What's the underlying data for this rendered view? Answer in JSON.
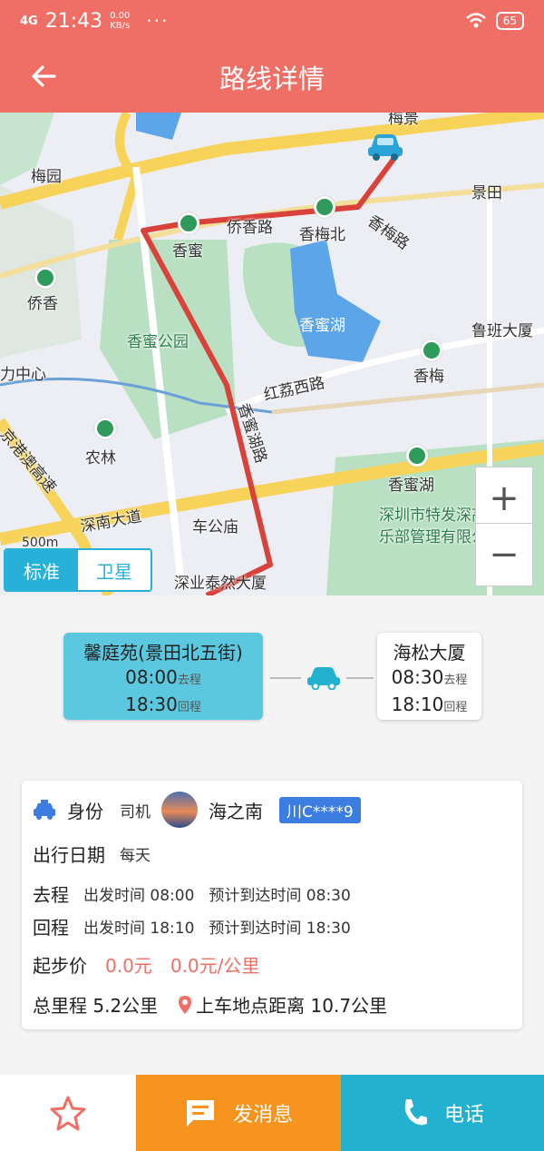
{
  "status_bar": {
    "network": "4G",
    "time": "21:43",
    "speed_value": "0.00",
    "speed_unit": "KB/s",
    "more": "···",
    "battery": "65"
  },
  "header": {
    "title": "路线详情"
  },
  "map": {
    "labels": {
      "meijing": "梅景",
      "meiyuan": "梅园",
      "jingtian": "景田",
      "qiaoxianglu": "侨香路",
      "xiangmi": "香蜜",
      "xiangmeibei": "香梅北",
      "xiangmeilu": "香梅路",
      "qiaoxiang": "侨香",
      "xiangmigongyuan": "香蜜公园",
      "xiangmihu": "香蜜湖",
      "lubandasha": "鲁班大厦",
      "lizhongxin": "力中心",
      "hongliwexilu": "红荔西路",
      "xiangmei": "香梅",
      "xiangmihulu": "香蜜湖路",
      "jinggangao": "京港澳高速",
      "nonglin": "农林",
      "xiangmihu2": "香蜜湖",
      "shennandadao": "深南大道",
      "chegongmiao": "车公庙",
      "club": "深圳市特发深高俱乐部管理有限公司",
      "shenyetairan": "深业泰然大厦",
      "scale": "500m"
    },
    "zoom_in": "+",
    "zoom_out": "−",
    "type_standard": "标准",
    "type_satellite": "卫星"
  },
  "route": {
    "from": {
      "name": "馨庭苑(景田北五街)",
      "go_time": "08:00",
      "go_label": "去程",
      "back_time": "18:30",
      "back_label": "回程"
    },
    "to": {
      "name": "海松大厦",
      "go_time": "08:30",
      "go_label": "去程",
      "back_time": "18:10",
      "back_label": "回程"
    }
  },
  "info": {
    "identity_label": "身份",
    "identity_value": "司机",
    "driver_name": "海之南",
    "plate": "川C****9",
    "date_label": "出行日期",
    "date_value": "每天",
    "go_label": "去程",
    "go_depart": "出发时间 08:00",
    "go_arrive": "预计到达时间 08:30",
    "back_label": "回程",
    "back_depart": "出发时间 18:10",
    "back_arrive": "预计到达时间 18:30",
    "price_label": "起步价",
    "price_start": "0.0元",
    "price_per_km": "0.0元/公里",
    "distance_label": "总里程 5.2公里",
    "pickup_distance": "上车地点距离 10.7公里"
  },
  "bottom": {
    "message_label": "发消息",
    "call_label": "电话"
  },
  "colors": {
    "primary": "#ef6f66",
    "accent_blue": "#27b0d8",
    "orange": "#f7941d",
    "route_red": "#d9423a"
  }
}
